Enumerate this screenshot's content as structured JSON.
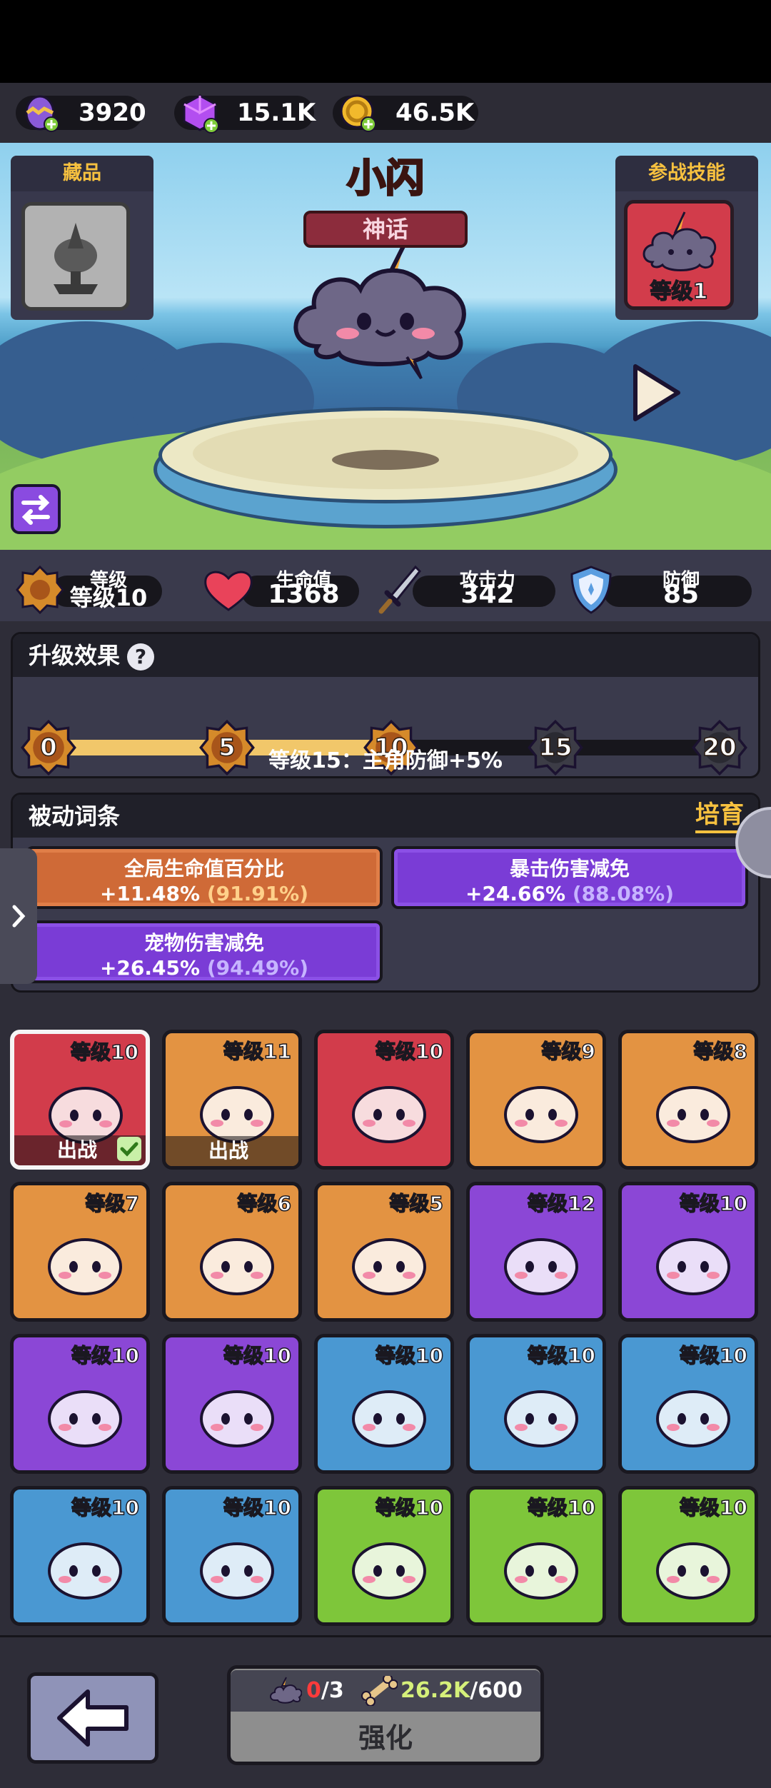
{
  "resources": {
    "egg_value": "3920",
    "gem_value": "15.1K",
    "coin_value": "46.5K"
  },
  "hero": {
    "name": "小闪",
    "rarity": "神话"
  },
  "collection": {
    "title": "藏品"
  },
  "battle_skill": {
    "title": "参战技能",
    "level": "等级1"
  },
  "stats": {
    "level_label": "等级",
    "level_value": "等级10",
    "hp_label": "生命值",
    "hp_value": "1368",
    "atk_label": "攻击力",
    "atk_value": "342",
    "def_label": "防御",
    "def_value": "85"
  },
  "upgrade_effect": {
    "title": "升级效果",
    "help": "?",
    "milestones": [
      "0",
      "5",
      "10",
      "15",
      "20"
    ],
    "current_level": 10,
    "max_level": 20,
    "next_bonus": "等级15：主角防御+5%"
  },
  "passive": {
    "title": "被动词条",
    "cultivate": "培育",
    "items": [
      {
        "name": "全局生命值百分比",
        "value": "+11.48%",
        "max": "(91.91%)"
      },
      {
        "name": "暴击伤害减免",
        "value": "+24.66%",
        "max": "(88.08%)"
      },
      {
        "name": "宠物伤害减免",
        "value": "+26.45%",
        "max": "(94.49%)"
      }
    ]
  },
  "pets": [
    {
      "level": "等级10",
      "deployed": "出战",
      "color": "#d23c4b"
    },
    {
      "level": "等级11",
      "deployed": "出战",
      "color": "#e39342"
    },
    {
      "level": "等级10",
      "deployed": "",
      "color": "#d23c4b"
    },
    {
      "level": "等级9",
      "deployed": "",
      "color": "#e39342"
    },
    {
      "level": "等级8",
      "deployed": "",
      "color": "#e39342"
    },
    {
      "level": "等级7",
      "deployed": "",
      "color": "#e39342"
    },
    {
      "level": "等级6",
      "deployed": "",
      "color": "#e39342"
    },
    {
      "level": "等级5",
      "deployed": "",
      "color": "#e39342"
    },
    {
      "level": "等级12",
      "deployed": "",
      "color": "#8b47d6"
    },
    {
      "level": "等级10",
      "deployed": "",
      "color": "#8b47d6"
    },
    {
      "level": "等级10",
      "deployed": "",
      "color": "#8b47d6"
    },
    {
      "level": "等级10",
      "deployed": "",
      "color": "#8b47d6"
    },
    {
      "level": "等级10",
      "deployed": "",
      "color": "#4a98d2"
    },
    {
      "level": "等级10",
      "deployed": "",
      "color": "#4a98d2"
    },
    {
      "level": "等级10",
      "deployed": "",
      "color": "#4a98d2"
    },
    {
      "level": "等级10",
      "deployed": "",
      "color": "#4a98d2"
    },
    {
      "level": "等级10",
      "deployed": "",
      "color": "#4a98d2"
    },
    {
      "level": "等级10",
      "deployed": "",
      "color": "#7ec63a"
    },
    {
      "level": "等级10",
      "deployed": "",
      "color": "#7ec63a"
    },
    {
      "level": "等级10",
      "deployed": "",
      "color": "#7ec63a"
    }
  ],
  "upgrade_button": {
    "shard_have": "0",
    "shard_need": "/3",
    "bone_have": "26.2K",
    "bone_need": "/600",
    "label": "强化"
  }
}
